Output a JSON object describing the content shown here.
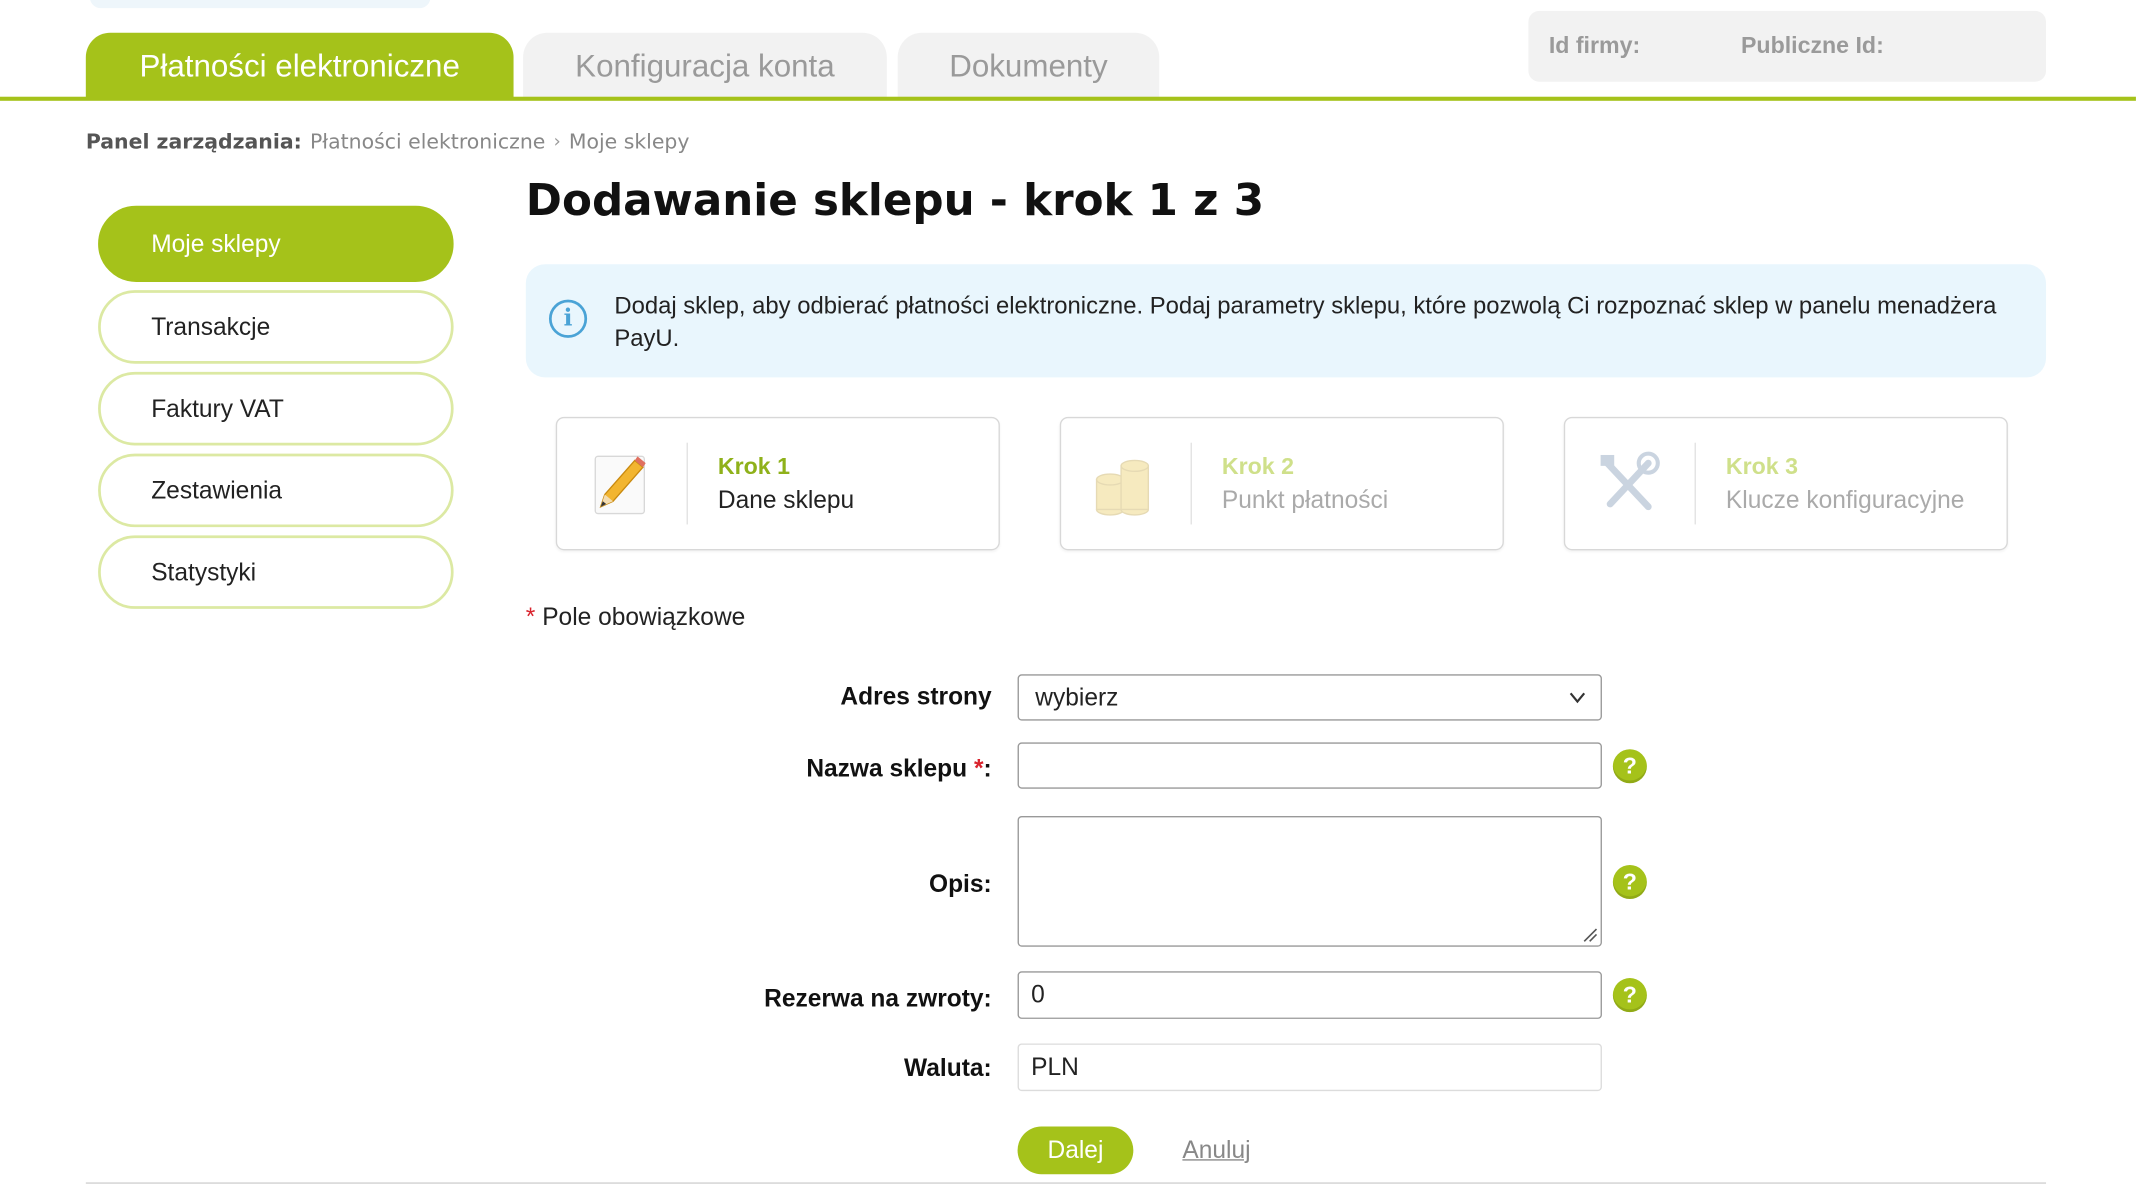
{
  "tabs": [
    {
      "label": "Płatności elektroniczne",
      "active": true
    },
    {
      "label": "Konfiguracja konta",
      "active": false
    },
    {
      "label": "Dokumenty",
      "active": false
    }
  ],
  "ids": {
    "firm_label": "Id firmy:",
    "public_label": "Publiczne Id:"
  },
  "breadcrumb": {
    "lead": "Panel zarządzania:",
    "items": [
      "Płatności elektroniczne",
      "Moje sklepy"
    ],
    "separator": "›"
  },
  "sidebar": {
    "items": [
      {
        "label": "Moje sklepy",
        "active": true
      },
      {
        "label": "Transakcje",
        "active": false
      },
      {
        "label": "Faktury VAT",
        "active": false
      },
      {
        "label": "Zestawienia",
        "active": false
      },
      {
        "label": "Statystyki",
        "active": false
      }
    ]
  },
  "page_title": "Dodawanie sklepu - krok 1 z 3",
  "info": {
    "text": "Dodaj sklep, aby odbierać płatności elektroniczne. Podaj parametry sklepu, które pozwolą Ci rozpoznać sklep w panelu menadżera PayU.",
    "icon": "info-icon",
    "icon_glyph": "i"
  },
  "steps": [
    {
      "title": "Krok 1",
      "desc": "Dane sklepu",
      "icon": "pencil-icon",
      "active": true
    },
    {
      "title": "Krok 2",
      "desc": "Punkt płatności",
      "icon": "coins-icon",
      "active": false
    },
    {
      "title": "Krok 3",
      "desc": "Klucze konfiguracyjne",
      "icon": "tools-icon",
      "active": false
    }
  ],
  "required_note": {
    "star": "*",
    "text": "Pole obowiązkowe"
  },
  "form": {
    "address": {
      "label": "Adres strony",
      "value": "wybierz"
    },
    "name": {
      "label": "Nazwa sklepu",
      "star": "*",
      "colon": ":",
      "value": ""
    },
    "description": {
      "label": "Opis:",
      "value": ""
    },
    "reserve": {
      "label": "Rezerwa na zwroty:",
      "value": "0"
    },
    "currency": {
      "label": "Waluta:",
      "value": "PLN"
    },
    "help_glyph": "?"
  },
  "actions": {
    "next_label": "Dalej",
    "cancel_label": "Anuluj"
  },
  "colors": {
    "accent": "#a5c21a",
    "info_bg": "#e9f6fd",
    "required": "#d9232d"
  }
}
